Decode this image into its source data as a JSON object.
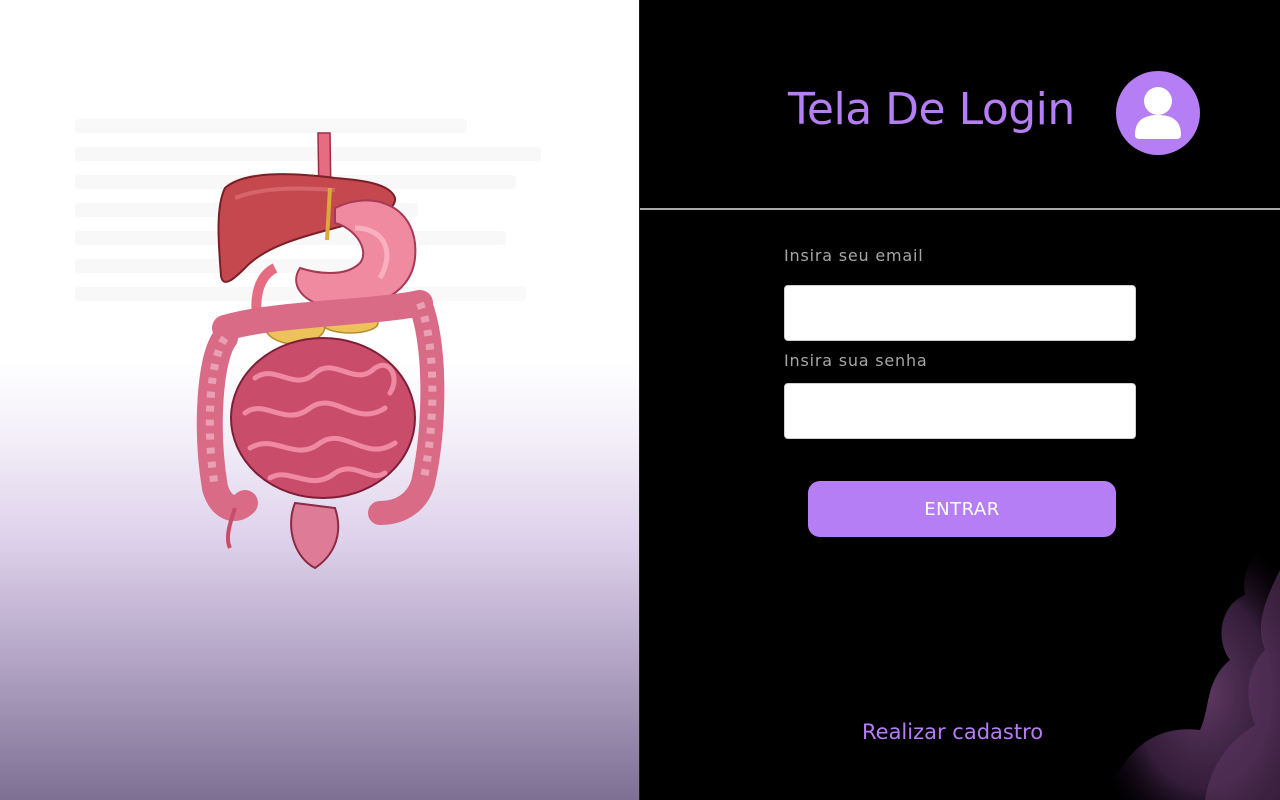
{
  "header": {
    "title": "Tela De Login"
  },
  "form": {
    "email_label": "Insira seu email",
    "email_value": "",
    "password_label": "Insira sua senha",
    "password_value": "",
    "submit_label": "ENTRAR"
  },
  "footer": {
    "register_link": "Realizar cadastro"
  },
  "icons": {
    "avatar": "user-icon",
    "illustration": "digestive-system-illustration"
  },
  "colors": {
    "accent": "#b57ef5",
    "background_right": "#000000",
    "label_gray": "#a6a6a6"
  }
}
